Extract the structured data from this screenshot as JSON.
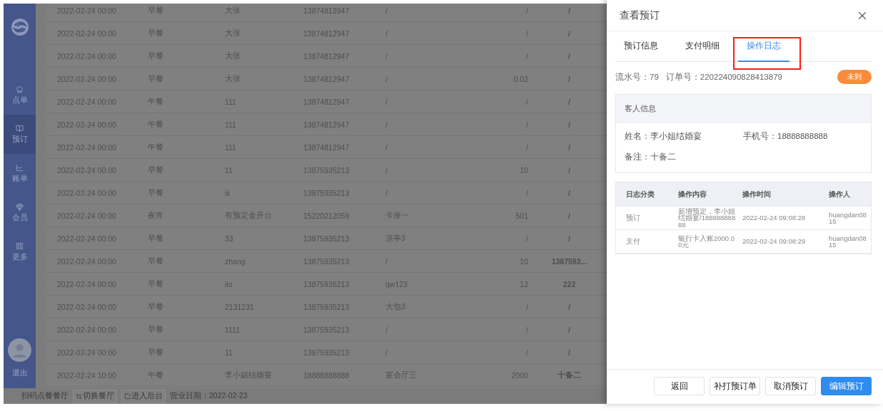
{
  "sidebar": {
    "items": [
      {
        "label": "点单",
        "selected": false
      },
      {
        "label": "预订",
        "selected": true
      },
      {
        "label": "账单",
        "selected": false
      },
      {
        "label": "会员",
        "selected": false
      },
      {
        "label": "更多",
        "selected": false
      }
    ],
    "logout": "退出"
  },
  "table": {
    "rows": [
      {
        "cells": [
          "2022-02-24 00:00",
          "早餐",
          "大张",
          "13874812947",
          "/",
          "/",
          "/"
        ]
      },
      {
        "cells": [
          "2022-02-24 00:00",
          "早餐",
          "大张",
          "13874812947",
          "/",
          "/",
          "/"
        ]
      },
      {
        "cells": [
          "2022-02-24 00:00",
          "早餐",
          "大张",
          "13874812947",
          "/",
          "/",
          "/"
        ]
      },
      {
        "cells": [
          "2022-02-24 00:00",
          "早餐",
          "大张",
          "13874812947",
          "/",
          "0.02",
          "/"
        ]
      },
      {
        "cells": [
          "2022-02-24 00:00",
          "午餐",
          "111",
          "13874812947",
          "/",
          "/",
          "/"
        ]
      },
      {
        "cells": [
          "2022-02-24 00:00",
          "午餐",
          "111",
          "13874812947",
          "/",
          "/",
          "/"
        ]
      },
      {
        "cells": [
          "2022-02-24 00:00",
          "午餐",
          "111",
          "13874812947",
          "/",
          "/",
          "/"
        ]
      },
      {
        "cells": [
          "2022-02-24 00:00",
          "早餐",
          "11",
          "13875935213",
          "/",
          "10",
          "/"
        ]
      },
      {
        "cells": [
          "2022-02-24 00:00",
          "早餐",
          "iii",
          "13875935213",
          "/",
          "/",
          "/"
        ]
      },
      {
        "cells": [
          "2022-02-24 00:00",
          "夜宵",
          "有预定金开台",
          "15220212059",
          "卡座一",
          "501",
          "/"
        ]
      },
      {
        "cells": [
          "2022-02-24 00:00",
          "早餐",
          "33",
          "13875935213",
          "凉亭3",
          "/",
          "/"
        ]
      },
      {
        "cells": [
          "2022-02-24 00:00",
          "早餐",
          "zhang",
          "13875935213",
          "/",
          "10",
          "1387593..."
        ]
      },
      {
        "cells": [
          "2022-02-24 00:00",
          "早餐",
          "iio",
          "13875935213",
          "qw123",
          "12",
          "222"
        ]
      },
      {
        "cells": [
          "2022-02-24 00:00",
          "早餐",
          "2131231",
          "13875935213",
          "大包3",
          "/",
          "/"
        ]
      },
      {
        "cells": [
          "2022-02-24 00:00",
          "早餐",
          "1111",
          "13875935213",
          "/",
          "/",
          "/"
        ]
      },
      {
        "cells": [
          "2022-02-24 00:00",
          "早餐",
          "11",
          "13875935213",
          "/",
          "/",
          "/"
        ]
      },
      {
        "cells": [
          "2022-02-24 10:00",
          "午餐",
          "李小姐结婚宴",
          "18888888888",
          "宴会厅三",
          "2000",
          "十备二"
        ]
      }
    ]
  },
  "status_bar": {
    "restaurant": "扫码点餐餐厅",
    "buttons": [
      {
        "label": "切换餐厅"
      },
      {
        "label": "进入后台"
      }
    ],
    "business_date": "营业日期：2022-02-23"
  },
  "drawer": {
    "title": "查看预订",
    "tabs": [
      {
        "label": "预订信息",
        "selected": false,
        "highlighted": false
      },
      {
        "label": "支付明细",
        "selected": false,
        "highlighted": false
      },
      {
        "label": "操作日志",
        "selected": true,
        "highlighted": true
      }
    ],
    "serial": "流水号：79",
    "order_no": "订单号：220224090828413879",
    "status": "未到",
    "guest_info": {
      "title": "客人信息",
      "fields": [
        "姓名：李小姐结婚宴",
        "手机号：18888888888",
        "备注：十备二"
      ]
    },
    "log": {
      "columns": [
        "日志分类",
        "操作内容",
        "操作时间",
        "操作人"
      ],
      "rows": [
        [
          "预订",
          "新增预定，李小姐结婚宴/18888888888",
          "2022-02-24 09:08:28",
          "huangdan0815"
        ],
        [
          "支付",
          "银行卡入账2000.00元",
          "2022-02-24 09:08:29",
          "huangdan0815"
        ]
      ]
    },
    "buttons": [
      {
        "label": "返回",
        "kind": "default"
      },
      {
        "label": "补打预订单",
        "kind": "default"
      },
      {
        "label": "取消预订",
        "kind": "default"
      },
      {
        "label": "编辑预订",
        "kind": "primary"
      }
    ]
  }
}
